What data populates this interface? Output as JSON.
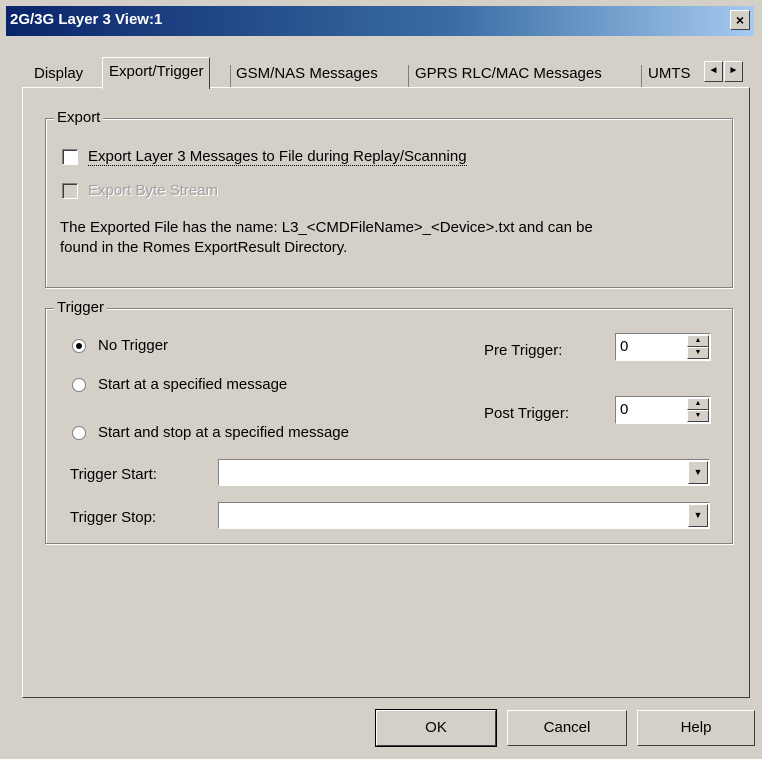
{
  "window": {
    "title": "2G/3G Layer 3 View:1",
    "close_glyph": "×"
  },
  "tabs": [
    {
      "label": "Display"
    },
    {
      "label": "Export/Trigger"
    },
    {
      "label": "GSM/NAS Messages"
    },
    {
      "label": "GPRS RLC/MAC Messages"
    },
    {
      "label": "UMTS"
    }
  ],
  "tab_scroll": {
    "left_icon": "◄",
    "right_icon": "►"
  },
  "export": {
    "legend": "Export",
    "export_l3_label": "Export Layer 3 Messages to File during Replay/Scanning",
    "export_l3_checked": false,
    "export_byte_label": "Export Byte Stream",
    "export_byte_checked": false,
    "info_line1": "The Exported File has the name: L3_<CMDFileName>_<Device>.txt and can be",
    "info_line2": "found in the Romes ExportResult Directory."
  },
  "trigger": {
    "legend": "Trigger",
    "options": [
      {
        "label": "No Trigger",
        "selected": true
      },
      {
        "label": "Start at a specified message",
        "selected": false
      },
      {
        "label": "Start and stop at a specified message",
        "selected": false
      }
    ],
    "pre_trigger_label": "Pre Trigger:",
    "pre_trigger_value": "0",
    "post_trigger_label": "Post Trigger:",
    "post_trigger_value": "0",
    "trigger_start_label": "Trigger Start:",
    "trigger_start_value": "",
    "trigger_stop_label": "Trigger Stop:",
    "trigger_stop_value": ""
  },
  "buttons": {
    "ok": "OK",
    "cancel": "Cancel",
    "help": "Help"
  },
  "icons": {
    "spin_up": "▲",
    "spin_down": "▼",
    "dropdown": "▼"
  },
  "colors": {
    "face": "#d4d0c8",
    "title_start": "#0a246a",
    "title_end": "#a6caf0"
  }
}
